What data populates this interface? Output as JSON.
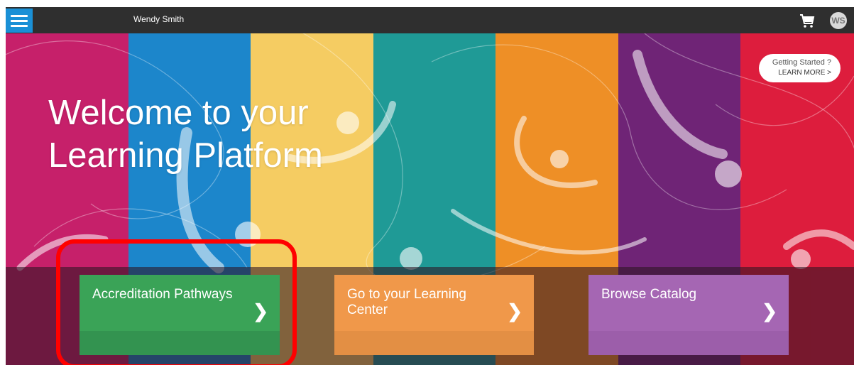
{
  "header": {
    "user_name": "Wendy Smith",
    "avatar_initials": "WS",
    "menu_icon": "hamburger-icon",
    "cart_icon": "cart-icon"
  },
  "hero": {
    "title_line1": "Welcome to your",
    "title_line2": "Learning Platform"
  },
  "getting_started": {
    "question": "Getting Started ?",
    "link": "LEARN MORE >"
  },
  "tiles": [
    {
      "label": "Accreditation Pathways",
      "color": "#3aa357",
      "arrow": "❯"
    },
    {
      "label": "Go to your Learning Center",
      "color": "#f0984a",
      "arrow": "❯"
    },
    {
      "label": "Browse Catalog",
      "color": "#a566b3",
      "arrow": "❯"
    }
  ],
  "colors": {
    "highlight": "#ff0000",
    "navbar": "#2f2f2f",
    "menu_button": "#1a90d6"
  }
}
